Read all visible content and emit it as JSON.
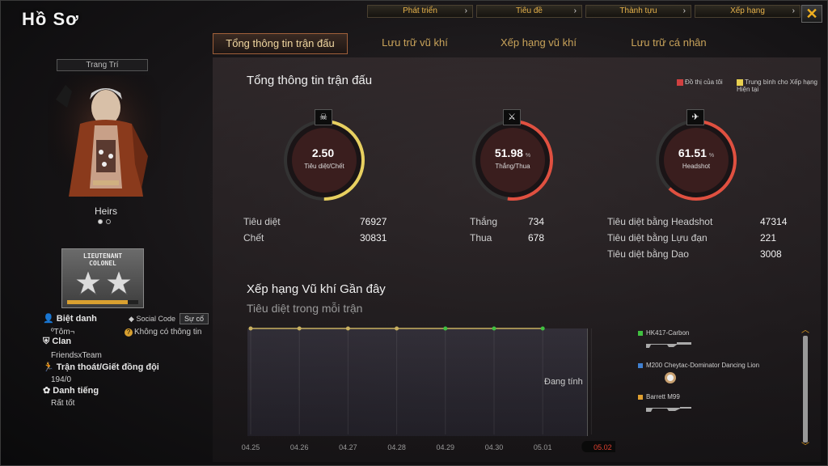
{
  "window": {
    "title": "Hồ Sơ",
    "close_icon": "close-icon"
  },
  "topnav": [
    {
      "label": "Phát triển"
    },
    {
      "label": "Tiêu đề"
    },
    {
      "label": "Thành tựu"
    },
    {
      "label": "Xếp hạng"
    }
  ],
  "tabs": [
    {
      "label": "Tổng thông tin trận đấu",
      "active": true
    },
    {
      "label": "Lưu trữ vũ khí"
    },
    {
      "label": "Xếp hạng vũ khí"
    },
    {
      "label": "Lưu trữ cá nhân"
    }
  ],
  "profile": {
    "decor_label": "Trang Trí",
    "character_name": "Heirs",
    "rank_text_line1": "LIEUTENANT",
    "rank_text_line2": "COLONEL",
    "rank_progress": 0.85,
    "nickname_label": "Biệt danh",
    "nickname_value": "ºTôm¬",
    "social_code_label": "Social Code",
    "social_button": "Sự cố",
    "no_info": "Không có thông tin",
    "clan_label": "Clan",
    "clan_value": "FriendsxTeam",
    "escape_label": "Trận thoát/Giết đồng đội",
    "escape_value": "194/0",
    "reputation_label": "Danh tiếng",
    "reputation_value": "Rất tốt"
  },
  "summary": {
    "title": "Tổng thông tin trận đấu",
    "legend_mine": "Đồ thị của tôi",
    "legend_avg": "Trung bình cho Xếp hạng Hiện tại",
    "legend_mine_color": "#d04040",
    "legend_avg_color": "#e8d050",
    "gauges": [
      {
        "value": "2.50",
        "unit": "",
        "label": "Tiêu diệt/Chết",
        "icon": "skull-icon",
        "fill": 0.5
      },
      {
        "value": "51.98",
        "unit": "%",
        "label": "Thắng/Thua",
        "icon": "crossed-swords-icon",
        "fill": 0.52
      },
      {
        "value": "61.51",
        "unit": "%",
        "label": "Headshot",
        "icon": "rifle-icon",
        "fill": 0.62
      }
    ],
    "stats_kd": [
      {
        "label": "Tiêu diệt",
        "value": "76927"
      },
      {
        "label": "Chết",
        "value": "30831"
      }
    ],
    "stats_wl": [
      {
        "label": "Thắng",
        "value": "734"
      },
      {
        "label": "Thua",
        "value": "678"
      }
    ],
    "stats_kill": [
      {
        "label": "Tiêu diệt bằng Headshot",
        "value": "47314"
      },
      {
        "label": "Tiêu diệt bằng Lựu đạn",
        "value": "221"
      },
      {
        "label": "Tiêu diệt bằng Dao",
        "value": "3008"
      }
    ]
  },
  "weapon_rank": {
    "title": "Xếp hạng Vũ khí Gần đây",
    "subtitle": "Tiêu diệt trong mỗi trận",
    "status": "Đang tính",
    "weapons": [
      {
        "name": "HK417-Carbon",
        "color": "#40c040"
      },
      {
        "name": "M200 Cheytac-Dominator Dancing Lion",
        "color": "#4080d0"
      },
      {
        "name": "Barrett M99",
        "color": "#e0a030"
      }
    ]
  },
  "chart_data": {
    "type": "line",
    "categories": [
      "04.25",
      "04.26",
      "04.27",
      "04.28",
      "04.29",
      "04.30",
      "05.01",
      "05.02"
    ],
    "selected_category": "05.02",
    "series": [
      {
        "values": [
          0,
          0,
          0,
          0,
          0,
          0,
          0
        ]
      }
    ],
    "point_colors": [
      "#c8b060",
      "#c8b060",
      "#c8b060",
      "#c8b060",
      "#40c040",
      "#40c040",
      "#40c040"
    ]
  }
}
